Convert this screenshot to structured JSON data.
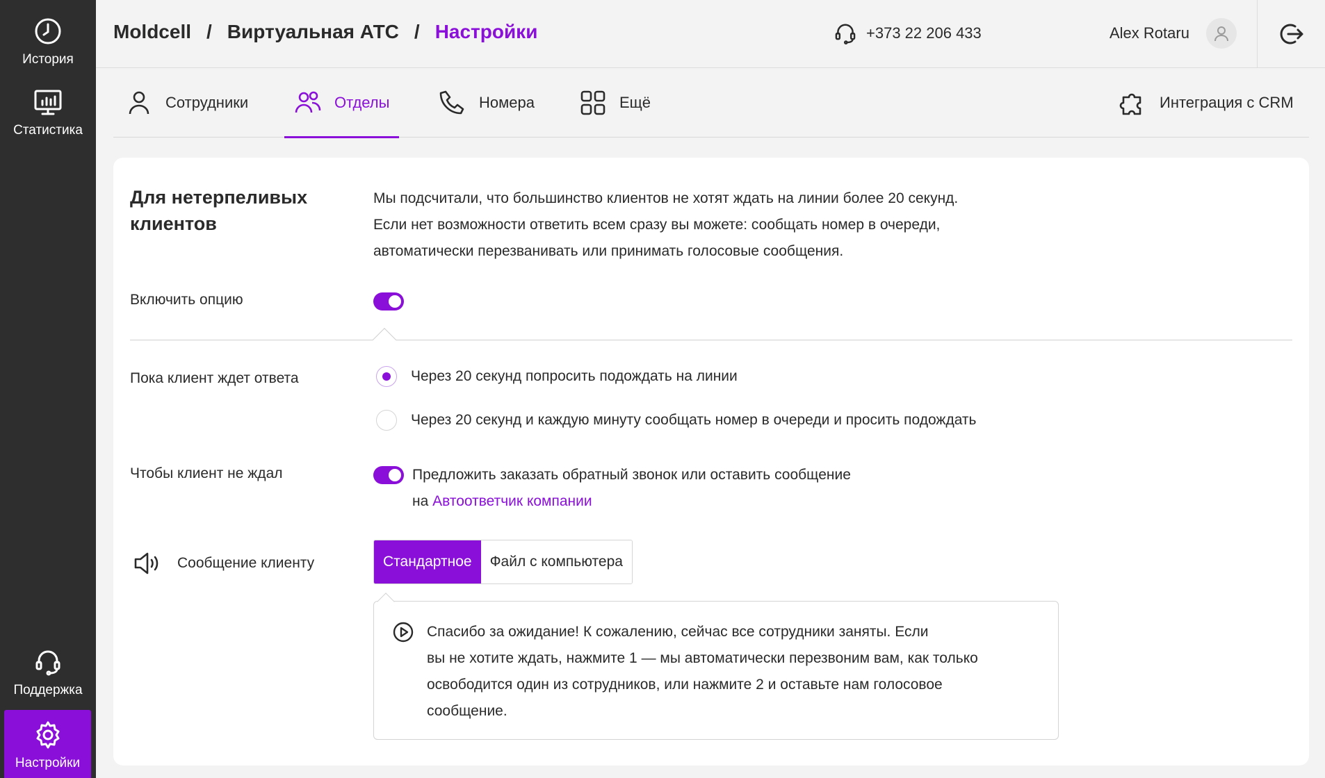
{
  "sidebar": {
    "items": [
      {
        "label": "История",
        "icon": "clock-icon"
      },
      {
        "label": "Статистика",
        "icon": "monitor-chart-icon"
      },
      {
        "label": "Поддержка",
        "icon": "headset-icon"
      },
      {
        "label": "Настройки",
        "icon": "gear-icon",
        "active": true
      }
    ]
  },
  "header": {
    "breadcrumb": [
      "Moldcell",
      "Виртуальная АТС",
      "Настройки"
    ],
    "separator": "/",
    "phone": "+373 22 206 433",
    "user_name": "Alex Rotaru"
  },
  "tabs": [
    {
      "label": "Сотрудники",
      "icon": "person-icon"
    },
    {
      "label": "Отделы",
      "icon": "group-icon",
      "active": true
    },
    {
      "label": "Номера",
      "icon": "phone-icon"
    },
    {
      "label": "Ещё",
      "icon": "grid-icon"
    },
    {
      "label": "Интеграция с CRM",
      "icon": "puzzle-icon"
    }
  ],
  "section": {
    "title": "Для нетерпеливых клиентов",
    "description": [
      "Мы подсчитали, что большинство клиентов не хотят ждать на линии более 20 секунд.",
      "Если нет возможности ответить всем сразу вы можете: сообщать номер в очереди,",
      "автоматически перезванивать или принимать голосовые сообщения."
    ],
    "enable_label": "Включить опцию",
    "enable_on": true,
    "waiting_label": "Пока клиент ждет ответа",
    "waiting_options": [
      {
        "label": "Через 20 секунд попросить подождать на линии",
        "checked": true
      },
      {
        "label": "Через 20 секунд и каждую минуту сообщать номер в очереди и просить подождать",
        "checked": false
      }
    ],
    "no_wait_label": "Чтобы клиент не ждал",
    "no_wait_on": true,
    "no_wait_text": "Предложить заказать обратный звонок или оставить сообщение",
    "no_wait_prefix": "на",
    "no_wait_link": "Автоответчик компании",
    "message_label": "Сообщение клиенту",
    "message_tabs": [
      "Стандартное",
      "Файл с компьютера"
    ],
    "message_text": [
      "Спасибо за ожидание! К сожалению, сейчас все сотрудники заняты. Если",
      "вы не хотите ждать, нажмите 1 — мы автоматически перезвоним вам, как только",
      "освободится один из сотрудников, или нажмите 2 и оставьте нам голосовое",
      "сообщение."
    ]
  },
  "colors": {
    "accent": "#8a0fd8",
    "sidebar_bg": "#2e2e2e",
    "page_bg": "#f2f3f2"
  }
}
